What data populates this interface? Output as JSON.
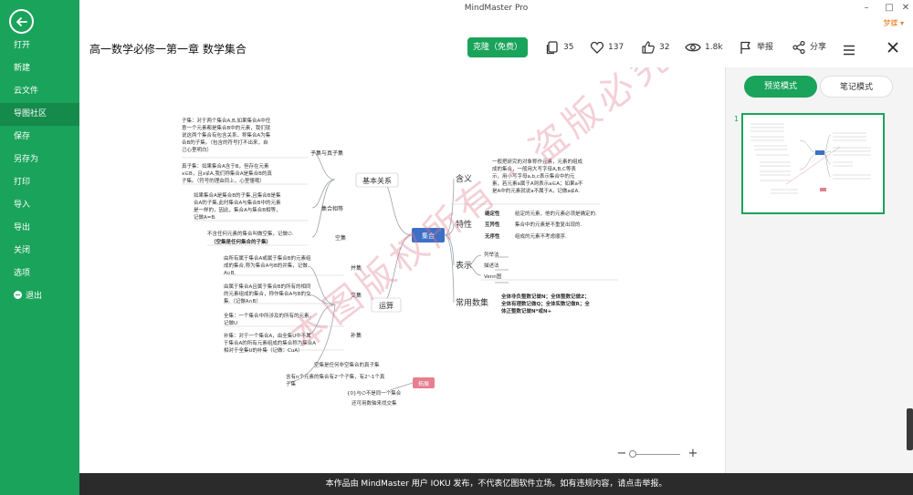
{
  "app": {
    "title": "MindMaster Pro",
    "user_name": "梦蝶",
    "window_controls": [
      "minimize",
      "maximize",
      "close"
    ]
  },
  "sidebar": {
    "items": [
      {
        "label": "打开"
      },
      {
        "label": "新建"
      },
      {
        "label": "云文件"
      },
      {
        "label": "导图社区",
        "active": true
      },
      {
        "label": "保存"
      },
      {
        "label": "另存为"
      },
      {
        "label": "打印"
      },
      {
        "label": "导入"
      },
      {
        "label": "导出"
      },
      {
        "label": "关闭"
      },
      {
        "label": "选项"
      },
      {
        "label": "退出"
      }
    ]
  },
  "header": {
    "doc_title": "高一数学必修一第一章 数学集合",
    "clone_label": "克隆（免费）",
    "stats": {
      "pages": "35",
      "likes": "137",
      "thumbs": "32",
      "views": "1.8k",
      "report": "举报",
      "share": "分享"
    }
  },
  "right_panel": {
    "preview_mode": "预览模式",
    "notes_mode": "笔记模式",
    "page_number": "1"
  },
  "footer": {
    "text": "本作品由 MindMaster 用户 IOKU 发布，不代表亿图软件立场。如有违规内容，请点击举报。"
  },
  "watermark": "本图版权所有 · 盗版必究",
  "mindmap": {
    "center": "集合",
    "left_branches": [
      {
        "label": "基本关系",
        "children": [
          {
            "label": "子集与真子集",
            "notes": [
              "子集：对于两个集合A,B,如果集合A中任",
              "意一个元素都是集合B中的元素，我们就",
              "说这两个集合有包含关系，称集合A为集",
              "合B的子集。（包含的符号打不出来，自",
              "己心里明白）",
              "真子集：如果集合A含于B，但存在元素",
              "x∈B，且x∉A,我们称集合A是集合B的真",
              "子集。（符号的理由同上，心里懂哦）"
            ]
          },
          {
            "label": "集合相等",
            "notes": [
              "如果集合A是集合B的子集,且集合B是集",
              "合A的子集,此时集合A与集合B中的元素",
              "是一样的，因此，集合A与集合B相等，",
              "记做A=B."
            ]
          },
          {
            "label": "空集",
            "notes": [
              "不含任何元素的集合叫做空集，记做∅.",
              "（空集是任何集合的子集）"
            ]
          }
        ]
      },
      {
        "label": "运算",
        "children": [
          {
            "label": "并集",
            "notes": [
              "由所有属于集合A或属于集合B的元素组",
              "成的集合,称为集合A与B的并集，记做",
              "A∪B."
            ]
          },
          {
            "label": "交集",
            "notes": [
              "由属于集合A且属于集合B的所有的相同",
              "的元素组成的集合，称作集合A与B的交",
              "集.（记做A∩B）"
            ]
          },
          {
            "label": "全集",
            "notes": [
              "全集：一个集合中所涉及的所有的元素，",
              "记做U"
            ]
          },
          {
            "label": "补集",
            "notes": [
              "补集：对于一个集合A，由全集U中不属",
              "于集合A的所有元素组成的集合称为集合A",
              "相对于全集U的补集（记做：CuA）"
            ]
          }
        ]
      }
    ],
    "extension": {
      "label": "拓展",
      "items": [
        "空集是任何非空集合的真子集",
        "含有n个元素的集合有2ⁿ个子集，有2ⁿ-1个真",
        "子集",
        "{0}与∅不是同一个集合",
        "还可用数轴来找交集"
      ]
    },
    "right_branches": [
      {
        "label": "含义",
        "notes": [
          "一般把研究的对象称作元素，元素的组成",
          "成的集合，一般用大写字母A,B,C等表",
          "示，用小写字母a,b,c表示集合中的元",
          "素，若元素a属于A则表示a∈A；如果a不",
          "是A中的元素就说a不属于A，记做a∉A."
        ]
      },
      {
        "label": "特性",
        "items": [
          {
            "name": "确定性",
            "desc": "给定的元素，他的元素必须是确定的."
          },
          {
            "name": "互异性",
            "desc": "集合中的元素是不重复出现的."
          },
          {
            "name": "无序性",
            "desc": "组成的元素不考虑顺序."
          }
        ]
      },
      {
        "label": "表示",
        "items": [
          "列举法",
          "描述法",
          "Venn图"
        ]
      },
      {
        "label": "常用数集",
        "notes": [
          "全体非负整数记做N；全体整数记做Z；",
          "全体有理数记做Q；全体实数记做R；全",
          "体正整数记做N*或N+"
        ]
      }
    ]
  }
}
